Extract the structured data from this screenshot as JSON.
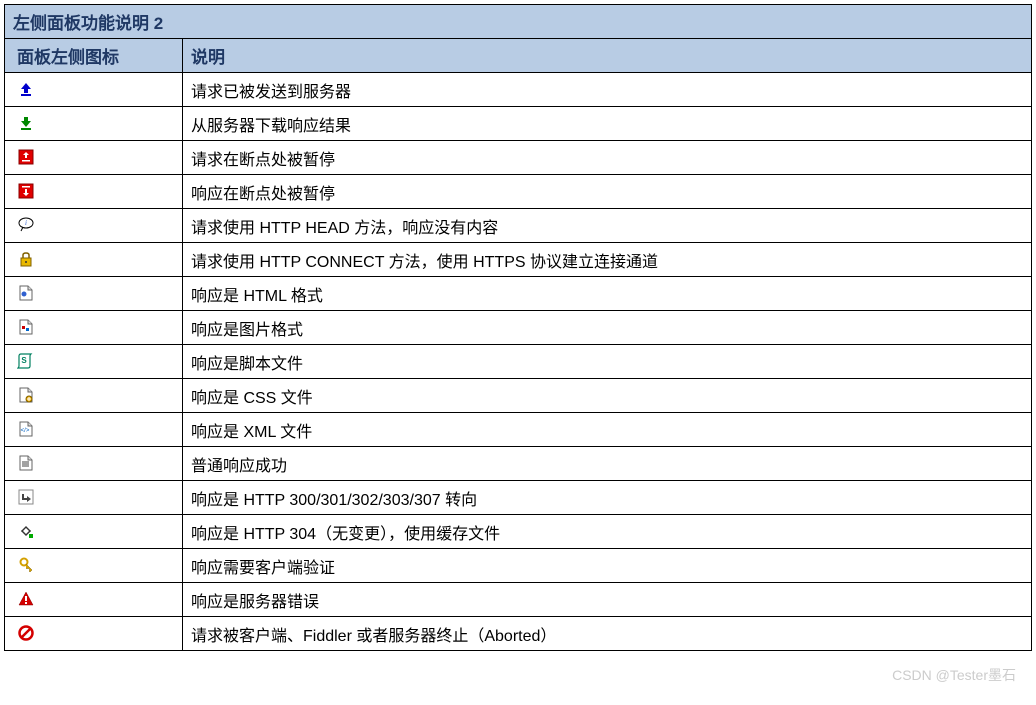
{
  "table": {
    "title": "左侧面板功能说明 2",
    "header": {
      "icon_col": "面板左侧图标",
      "desc_col": "说明"
    },
    "rows": [
      {
        "icon": "upload-icon",
        "desc": "请求已被发送到服务器"
      },
      {
        "icon": "download-icon",
        "desc": "从服务器下载响应结果"
      },
      {
        "icon": "breakpoint-req-icon",
        "desc": "请求在断点处被暂停"
      },
      {
        "icon": "breakpoint-res-icon",
        "desc": "响应在断点处被暂停"
      },
      {
        "icon": "head-icon",
        "desc": "请求使用 HTTP HEAD 方法，响应没有内容"
      },
      {
        "icon": "lock-icon",
        "desc": "请求使用 HTTP CONNECT 方法，使用 HTTPS 协议建立连接通道"
      },
      {
        "icon": "html-icon",
        "desc": "响应是 HTML 格式"
      },
      {
        "icon": "image-icon",
        "desc": "响应是图片格式"
      },
      {
        "icon": "script-icon",
        "desc": "响应是脚本文件"
      },
      {
        "icon": "css-icon",
        "desc": "响应是 CSS 文件"
      },
      {
        "icon": "xml-icon",
        "desc": "响应是 XML 文件"
      },
      {
        "icon": "success-icon",
        "desc": "普通响应成功"
      },
      {
        "icon": "redirect-icon",
        "desc": "响应是 HTTP 300/301/302/303/307 转向"
      },
      {
        "icon": "cache-icon",
        "desc": "响应是 HTTP 304（无变更），使用缓存文件"
      },
      {
        "icon": "auth-icon",
        "desc": "响应需要客户端验证"
      },
      {
        "icon": "error-icon",
        "desc": "响应是服务器错误"
      },
      {
        "icon": "aborted-icon",
        "desc": "请求被客户端、Fiddler 或者服务器终止（Aborted）"
      }
    ]
  },
  "watermark": "CSDN @Tester墨石"
}
